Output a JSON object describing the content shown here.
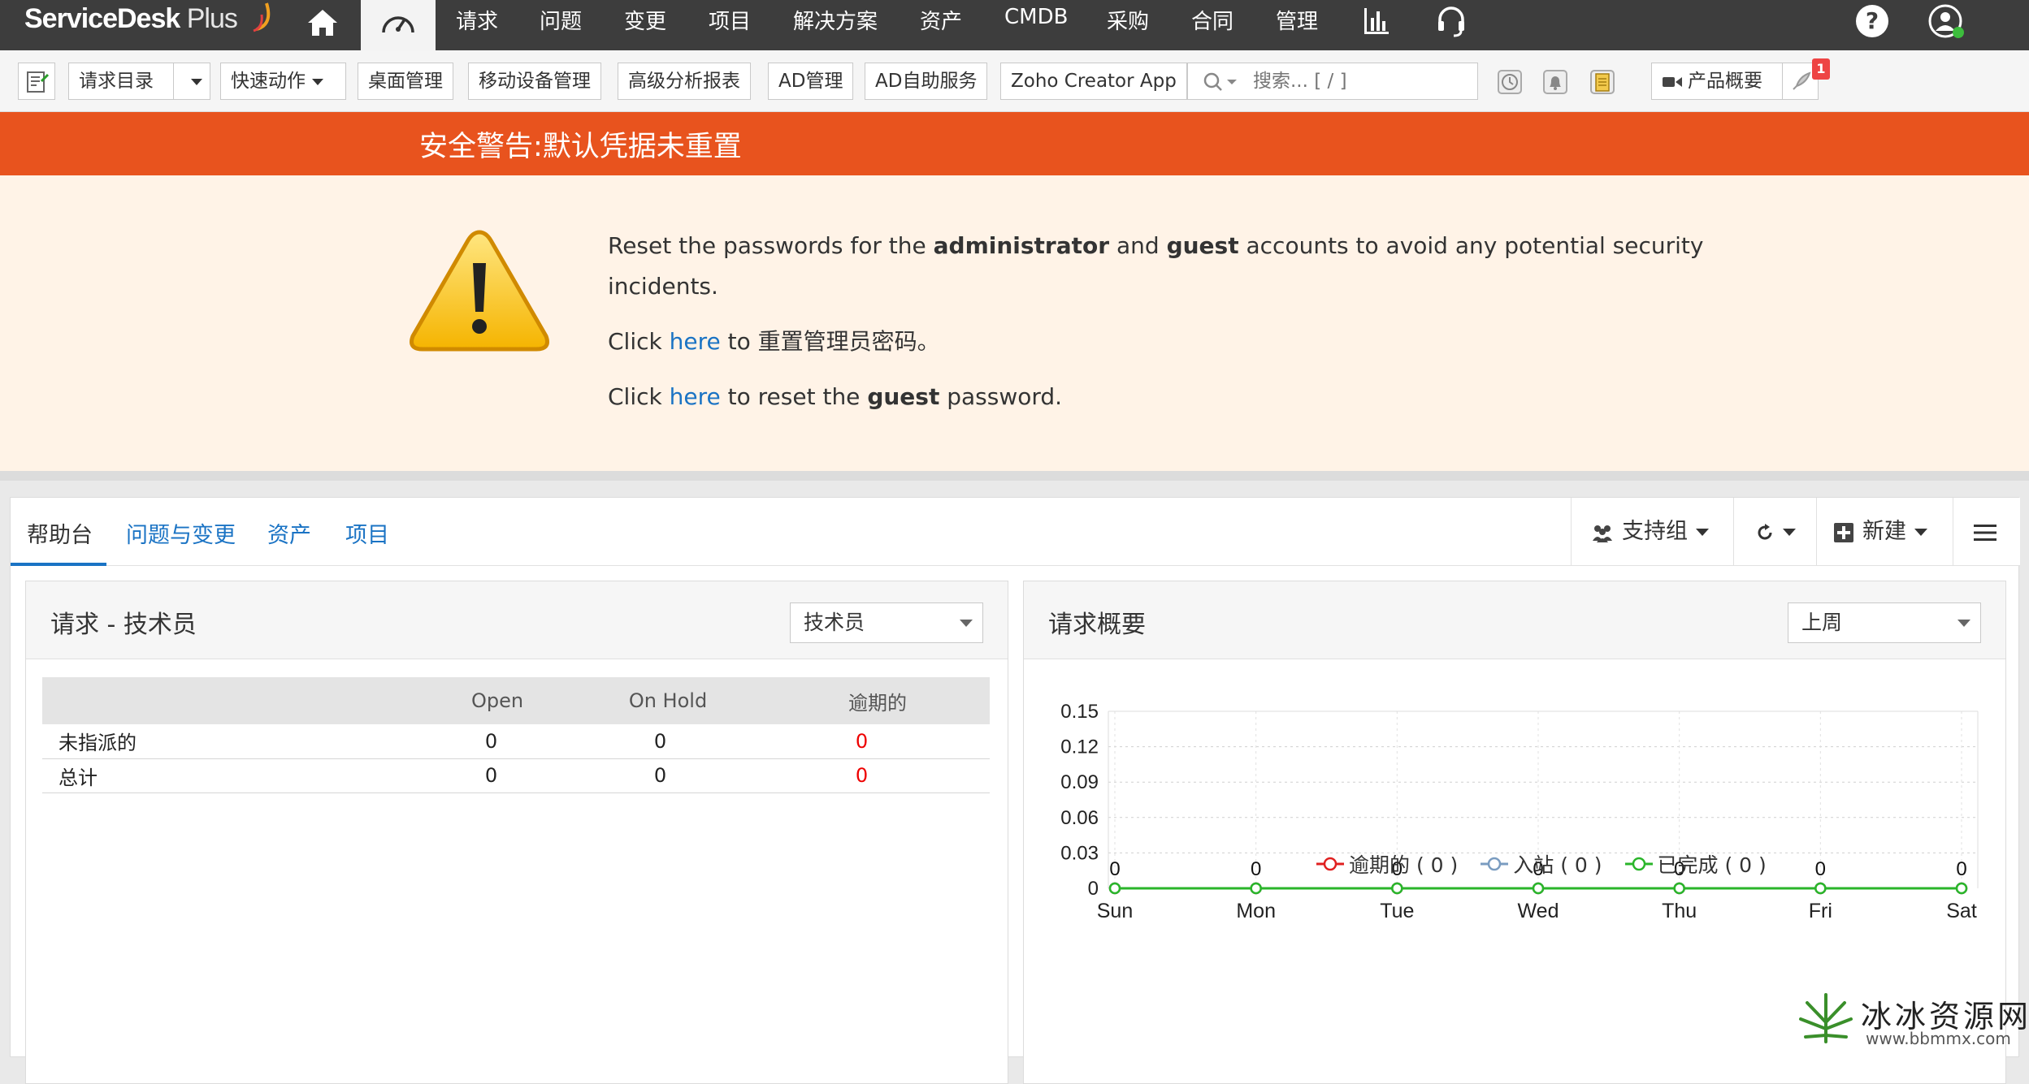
{
  "topnav": {
    "logo_main": "ServiceDesk",
    "logo_plus": " Plus",
    "items": [
      "请求",
      "问题",
      "变更",
      "项目",
      "解决方案",
      "资产",
      "CMDB",
      "采购",
      "合同",
      "管理"
    ],
    "help": "?"
  },
  "toolbar": {
    "catalog": "请求目录",
    "quick_actions": "快速动作",
    "buttons": [
      "桌面管理",
      "移动设备管理",
      "高级分析报表",
      "AD管理",
      "AD自助服务",
      "Zoho Creator App"
    ],
    "search_placeholder": "搜索... [ / ]",
    "overview": "产品概要",
    "badge": "1"
  },
  "alert": {
    "title": "安全警告:默认凭据未重置",
    "line1_pre": "Reset the passwords for the ",
    "line1_b1": "administrator",
    "line1_mid": " and ",
    "line1_b2": "guest",
    "line1_post": " accounts to avoid any potential security",
    "line1_wrap": "incidents.",
    "line2_pre": "Click ",
    "line2_link": "here",
    "line2_post": " to 重置管理员密码。",
    "line3_pre": "Click ",
    "line3_link": "here",
    "line3_mid": " to reset the ",
    "line3_b": "guest",
    "line3_post": " password."
  },
  "tabs": {
    "items": [
      "帮助台",
      "问题与变更",
      "资产",
      "项目"
    ],
    "support_group": "支持组",
    "new": "新建"
  },
  "req_panel": {
    "title": "请求 - 技术员",
    "select": "技术员",
    "columns": [
      "",
      "Open",
      "On Hold",
      "逾期的"
    ],
    "rows": [
      {
        "label": "未指派的",
        "open": "0",
        "onhold": "0",
        "overdue": "0"
      },
      {
        "label": "总计",
        "open": "0",
        "onhold": "0",
        "overdue": "0"
      }
    ]
  },
  "summary_panel": {
    "title": "请求概要",
    "select": "上周"
  },
  "chart_data": {
    "type": "line",
    "categories": [
      "Sun",
      "Mon",
      "Tue",
      "Wed",
      "Thu",
      "Fri",
      "Sat"
    ],
    "ylim": [
      0,
      0.15
    ],
    "yticks": [
      "0",
      "0.03",
      "0.06",
      "0.09",
      "0.12",
      "0.15"
    ],
    "grid": true,
    "series": [
      {
        "name": "逾期的 ( 0 )",
        "color": "#e02020",
        "values": [
          0,
          0,
          0,
          0,
          0,
          0,
          0
        ]
      },
      {
        "name": "入站 ( 0 )",
        "color": "#7a9cc0",
        "values": [
          0,
          0,
          0,
          0,
          0,
          0,
          0
        ]
      },
      {
        "name": "已完成 ( 0 )",
        "color": "#2ab52a",
        "values": [
          0,
          0,
          0,
          0,
          0,
          0,
          0
        ]
      }
    ],
    "data_labels": [
      "0",
      "0",
      "0",
      "0",
      "0",
      "0",
      "0"
    ],
    "legend": "bottom"
  },
  "watermark": {
    "text": "冰冰资源网",
    "url": "www.bbmmx.com"
  }
}
